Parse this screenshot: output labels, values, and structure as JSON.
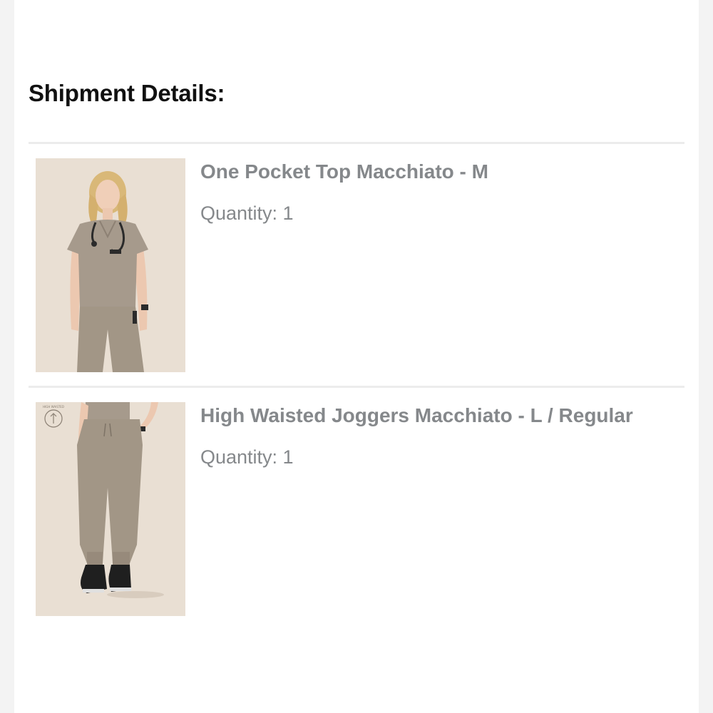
{
  "shipment": {
    "title": "Shipment Details:",
    "items": [
      {
        "name": "One Pocket Top Macchiato - M",
        "quantity": "Quantity: 1",
        "image_icon": "product-photo-scrub-top"
      },
      {
        "name": "High Waisted Joggers Macchiato - L / Regular",
        "quantity": "Quantity: 1",
        "image_icon": "product-photo-joggers",
        "badge_text": "HIGH WAISTED"
      }
    ]
  },
  "colors": {
    "photo_background": "#e9dfd3",
    "garment": "#a69a8c",
    "text_muted": "#85888b"
  }
}
